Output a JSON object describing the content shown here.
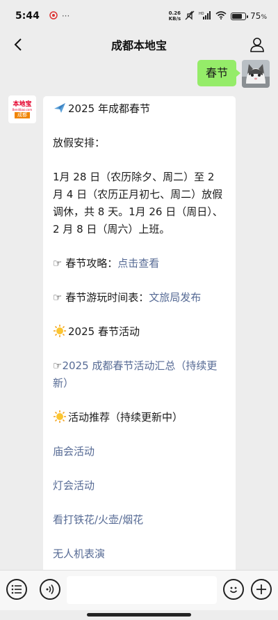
{
  "status_bar": {
    "time": "5:44",
    "net_speed_value": "0.26",
    "net_speed_unit": "KB/s",
    "battery_level": "75",
    "battery_suffix": "%",
    "battery_fraction": 0.75
  },
  "header": {
    "title": "成都本地宝",
    "back_icon": "chevron-left-icon",
    "profile_icon": "person-icon"
  },
  "sent_message": {
    "text": "春节"
  },
  "bot_avatar": {
    "logo_main": "本地宝",
    "logo_url": "Bendibao.com",
    "logo_city": "成都"
  },
  "received_message": {
    "heading": "2025 年成都春节",
    "holiday_label": "放假安排：",
    "holiday_text": "1月 28 日（农历除夕、周二）至 2 月 4 日（农历正月初七、周二）放假调休，共 8 天。1月 26 日（周日）、2 月 8 日（周六）上班。",
    "guide_prefix": "☞ 春节攻略：",
    "guide_link": "点击查看",
    "schedule_prefix": "☞ 春节游玩时间表：",
    "schedule_link": "文旅局发布",
    "activities_heading": "2025 春节活动",
    "summary_prefix": "☞",
    "summary_link": "2025 成都春节活动汇总（持续更新）",
    "recommend_heading": "活动推荐（持续更新中）",
    "links": [
      "庙会活动",
      "灯会活动",
      "看打铁花/火壶/烟花",
      "无人机表演"
    ]
  },
  "bottom_bar": {
    "menu_icon": "menu-list-icon",
    "voice_icon": "voice-icon",
    "emoji_icon": "emoji-icon",
    "plus_icon": "plus-icon"
  },
  "colors": {
    "background": "#ededed",
    "sent_bubble": "#95ec69",
    "link": "#576b95"
  }
}
